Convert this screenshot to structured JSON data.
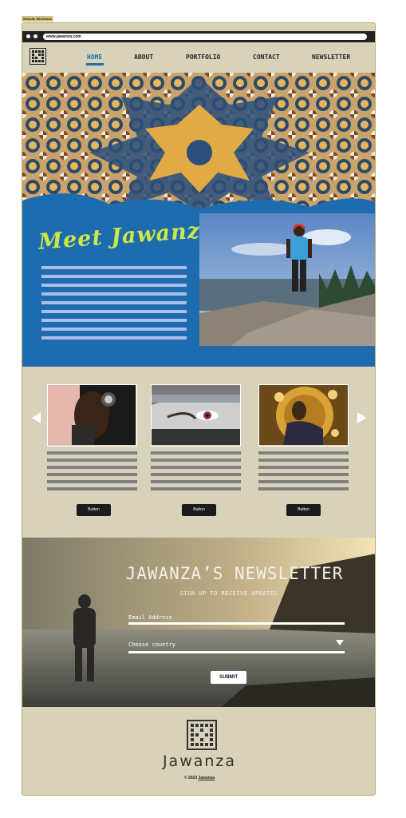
{
  "frame_tag": "Website Wireframe",
  "browser": {
    "url": "www.jawanza.com"
  },
  "nav": {
    "items": [
      {
        "label": "HOME",
        "active": true
      },
      {
        "label": "ABOUT",
        "active": false
      },
      {
        "label": "PORTFOLIO",
        "active": false
      },
      {
        "label": "CONTACT",
        "active": false
      },
      {
        "label": "NEWSLETTER",
        "active": false
      }
    ]
  },
  "meet": {
    "title": "Meet Jawanza"
  },
  "gallery": {
    "cards": [
      {
        "button": "Button"
      },
      {
        "button": "Button"
      },
      {
        "button": "Button"
      }
    ]
  },
  "newsletter": {
    "title": "JAWANZA’S NEWSLETTER",
    "subtitle": "SIGN UP TO RECEIVE UPDATES",
    "email_label": "Email Address",
    "country_label": "Choose country",
    "submit": "SUBMIT"
  },
  "footer": {
    "brand": "Jawanza",
    "copyright_prefix": "© 2023",
    "copyright_link": "Jawanza"
  },
  "colors": {
    "accent_blue": "#1e6cb0",
    "title_green": "#cde64a",
    "page_bg": "#d8d2bb"
  }
}
